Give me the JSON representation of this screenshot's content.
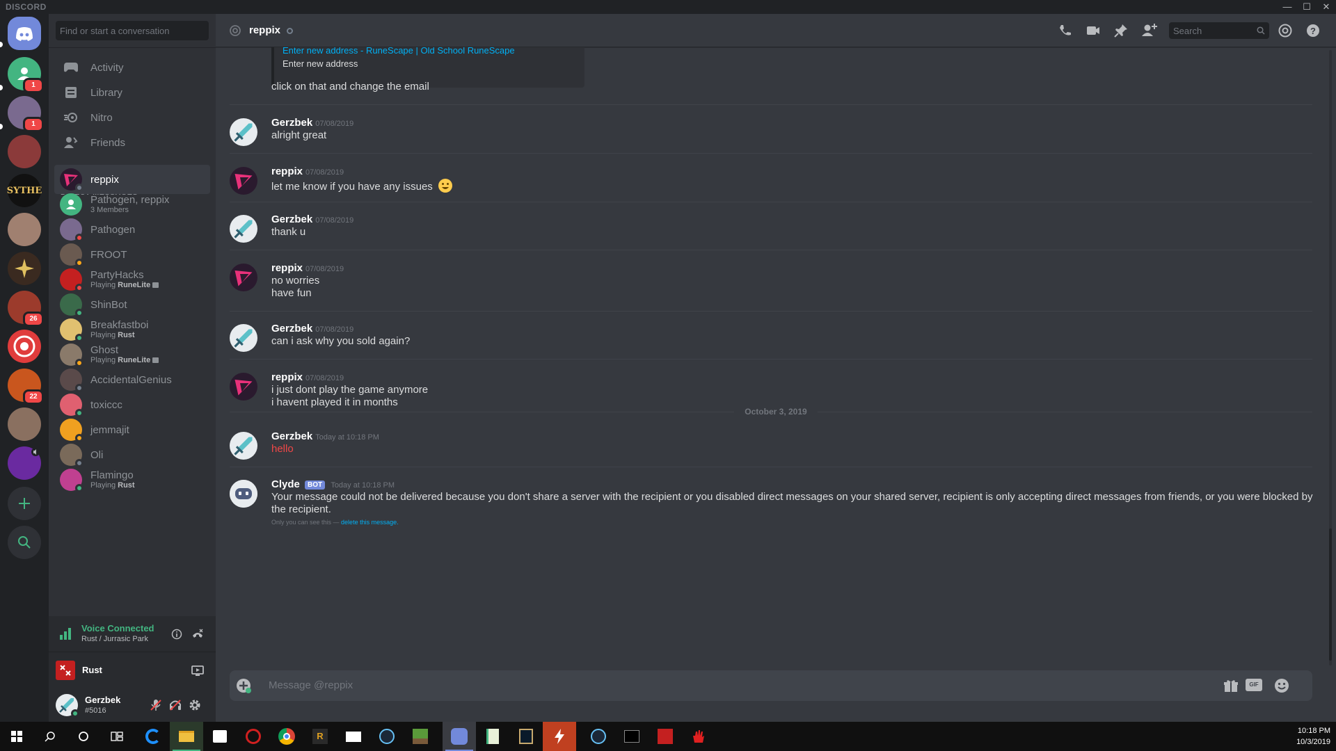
{
  "app": {
    "brand": "DISCORD",
    "window_controls": [
      "—",
      "☐",
      "✕"
    ]
  },
  "guilds": [
    {
      "name": "home",
      "color": "#7289da",
      "icon": "discord-logo-icon"
    },
    {
      "name": "friends-group",
      "color": "#43b581",
      "badge": "1"
    },
    {
      "name": "server-anime",
      "color": "#7a6a8f",
      "badge": "1"
    },
    {
      "name": "server-building",
      "color": "#8b3a3a"
    },
    {
      "name": "SYTHE",
      "color": "#111111",
      "label": "SYTHE"
    },
    {
      "name": "server-face",
      "color": "#a08070"
    },
    {
      "name": "server-star",
      "color": "#3a2a20"
    },
    {
      "name": "server-rust",
      "color": "#9c3b2c",
      "badge": "26"
    },
    {
      "name": "server-red-circle",
      "color": "#e03c3c"
    },
    {
      "name": "server-orange",
      "color": "#c9561e",
      "badge": "22"
    },
    {
      "name": "server-cat",
      "color": "#8a7060"
    },
    {
      "name": "server-purple",
      "color": "#6a2aa0"
    }
  ],
  "sidebar": {
    "search_placeholder": "Find or start a conversation",
    "nav": [
      {
        "label": "Activity",
        "icon": "controller-icon"
      },
      {
        "label": "Library",
        "icon": "library-icon"
      },
      {
        "label": "Nitro",
        "icon": "nitro-icon"
      },
      {
        "label": "Friends",
        "icon": "friends-icon"
      }
    ],
    "dm_header": "DIRECT MESSAGES",
    "dms": [
      {
        "name": "reppix",
        "sub": "",
        "color": "#2a1a2e",
        "status": "#747f8d",
        "active": true
      },
      {
        "name": "Pathogen, reppix",
        "sub": "3 Members",
        "color": "#43b581",
        "status": ""
      },
      {
        "name": "Pathogen",
        "sub": "",
        "color": "#7a6a8f",
        "status": "#f04747"
      },
      {
        "name": "FROOT",
        "sub": "",
        "color": "#6a5a50",
        "status": "#faa61a"
      },
      {
        "name": "PartyHacks",
        "sub_prefix": "Playing ",
        "sub_game": "RuneLite",
        "color": "#c42020",
        "status": "#f04747"
      },
      {
        "name": "ShinBot",
        "sub": "",
        "color": "#3a6a4a",
        "status": "#43b581"
      },
      {
        "name": "Breakfastboi",
        "sub_prefix": "Playing ",
        "sub_game": "Rust",
        "color": "#e0c070",
        "status": "#43b581"
      },
      {
        "name": "Ghost",
        "sub_prefix": "Playing ",
        "sub_game": "RuneLite",
        "color": "#8a7a6a",
        "status": "#faa61a"
      },
      {
        "name": "AccidentalGenius",
        "sub": "",
        "color": "#5a4a4a",
        "status": "#747f8d"
      },
      {
        "name": "toxiccc",
        "sub": "",
        "color": "#e06070",
        "status": "#43b581"
      },
      {
        "name": "jemmajit",
        "sub": "",
        "color": "#f0a020",
        "status": "#faa61a"
      },
      {
        "name": "Oli",
        "sub": "",
        "color": "#7a6a5a",
        "status": "#747f8d"
      },
      {
        "name": "Flamingo",
        "sub_prefix": "Playing ",
        "sub_game": "Rust",
        "color": "#c04090",
        "status": "#43b581"
      }
    ],
    "voice": {
      "title": "Voice Connected",
      "sub": "Rust / Jurrasic Park"
    },
    "game": {
      "name": "Rust"
    },
    "user": {
      "name": "Gerzbek",
      "tag": "#5016"
    }
  },
  "chat": {
    "channel": "reppix",
    "search_placeholder": "Search",
    "embed_link": "Enter new address - RuneScape | Old School RuneScape",
    "embed_desc": "Enter new address",
    "top_line": "click on that and change the email",
    "messages": [
      {
        "user": "Gerzbek",
        "time": "07/08/2019",
        "lines": [
          "alright great"
        ]
      },
      {
        "user": "reppix",
        "time": "07/08/2019",
        "lines": [
          "let me know if you have any issues"
        ],
        "emoji": true
      },
      {
        "user": "Gerzbek",
        "time": "07/08/2019",
        "lines": [
          "thank u"
        ]
      },
      {
        "user": "reppix",
        "time": "07/08/2019",
        "lines": [
          "no worries",
          "have fun"
        ]
      },
      {
        "user": "Gerzbek",
        "time": "07/08/2019",
        "lines": [
          "can i ask why you sold again?"
        ]
      },
      {
        "user": "reppix",
        "time": "07/08/2019",
        "lines": [
          "i just dont play the game anymore",
          "i havent played it in months"
        ]
      },
      {
        "user": "Gerzbek",
        "time": "Today at 10:18 PM",
        "lines": [
          "hello"
        ],
        "failed": true
      },
      {
        "user": "Clyde",
        "bot": "BOT",
        "time": "Today at 10:18 PM",
        "lines": [
          "Your message could not be delivered because you don't share a server with the recipient or you disabled direct messages on your shared server, recipient is only accepting direct messages from friends, or you were blocked by",
          "the recipient."
        ]
      }
    ],
    "date_divider": "October 3, 2019",
    "clyde_note_prefix": "Only you can see this — ",
    "clyde_note_link": "delete this message.",
    "composer_placeholder": "Message @reppix"
  },
  "taskbar": {
    "time": "10:18 PM",
    "date": "10/3/2019"
  }
}
